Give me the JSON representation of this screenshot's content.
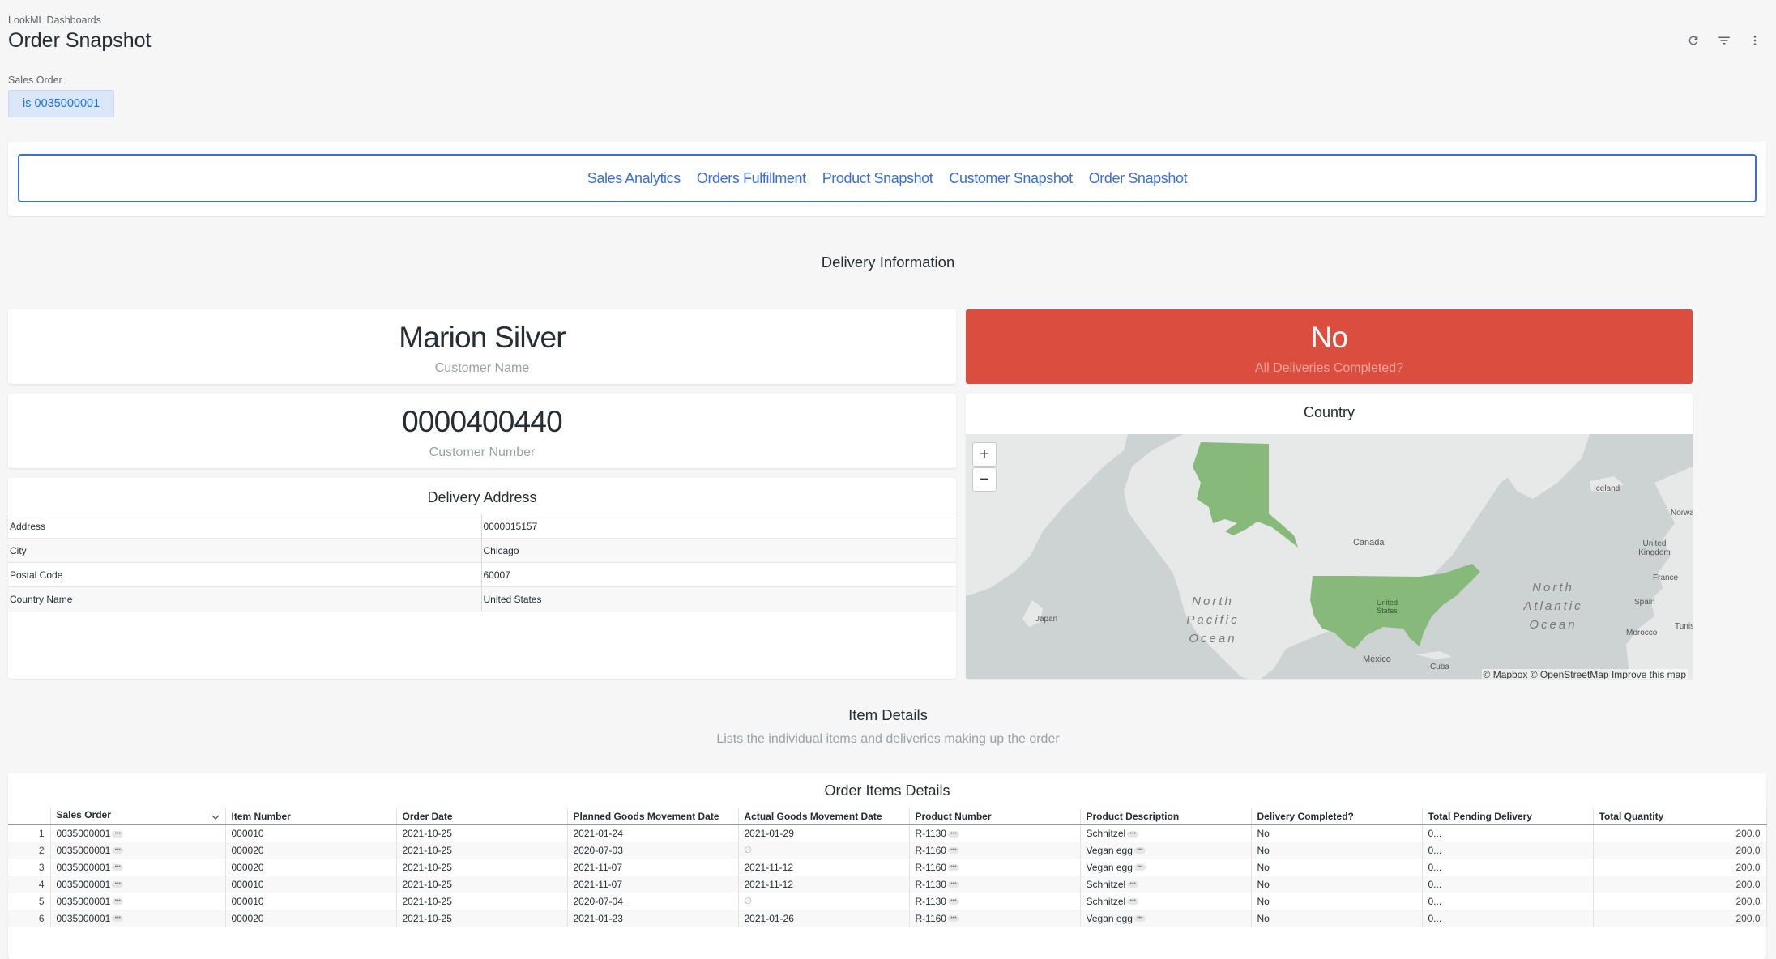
{
  "header": {
    "breadcrumb": "LookML Dashboards",
    "title": "Order Snapshot"
  },
  "filter": {
    "label": "Sales Order",
    "value": "is 0035000001"
  },
  "nav_links": [
    "Sales Analytics",
    "Orders Fulfillment",
    "Product Snapshot",
    "Customer Snapshot",
    "Order Snapshot"
  ],
  "sections": {
    "delivery_title": "Delivery Information",
    "items_title": "Item Details",
    "items_subtitle": "Lists the individual items and deliveries making up the order"
  },
  "kpis": {
    "customer_name": {
      "value": "Marion Silver",
      "label": "Customer Name"
    },
    "customer_number": {
      "value": "0000400440",
      "label": "Customer Number"
    },
    "deliveries_completed": {
      "value": "No",
      "label": "All Deliveries Completed?"
    }
  },
  "delivery_address": {
    "title": "Delivery Address",
    "rows": [
      {
        "field": "Address",
        "value": "0000015157"
      },
      {
        "field": "City",
        "value": "Chicago"
      },
      {
        "field": "Postal Code",
        "value": "60007"
      },
      {
        "field": "Country Name",
        "value": "United States"
      }
    ]
  },
  "map": {
    "title": "Country",
    "zoom_in": "+",
    "zoom_out": "−",
    "labels": {
      "canada": "Canada",
      "united_states": "United States",
      "mexico": "Mexico",
      "cuba": "Cuba",
      "japan": "Japan",
      "iceland": "Iceland",
      "norway": "Norwa",
      "uk": "United Kingdom",
      "france": "France",
      "spain": "Spain",
      "morocco": "Morocco",
      "tunisia": "Tunis",
      "north_pacific": "North Pacific Ocean",
      "north_atlantic": "North Atlantic Ocean"
    },
    "attribution": "© Mapbox © OpenStreetMap Improve this map",
    "highlight_color": "#86b97a",
    "sea_color": "#cdd2d3",
    "land_color": "#e7e9e8"
  },
  "order_items": {
    "title": "Order Items Details",
    "columns": [
      "Sales Order",
      "Item Number",
      "Order Date",
      "Planned Goods Movement Date",
      "Actual Goods Movement Date",
      "Product Number",
      "Product Description",
      "Delivery Completed?",
      "Total Pending Delivery",
      "Total Quantity"
    ],
    "rows": [
      {
        "idx": "1",
        "sales_order": "0035000001",
        "item": "000010",
        "order_date": "2021-10-25",
        "planned": "2021-01-24",
        "actual": "2021-01-29",
        "product": "R-1130",
        "desc": "Schnitzel",
        "completed": "No",
        "pending": "0...",
        "qty": "200.0"
      },
      {
        "idx": "2",
        "sales_order": "0035000001",
        "item": "000020",
        "order_date": "2021-10-25",
        "planned": "2020-07-03",
        "actual": "∅",
        "product": "R-1160",
        "desc": "Vegan egg",
        "completed": "No",
        "pending": "0...",
        "qty": "200.0"
      },
      {
        "idx": "3",
        "sales_order": "0035000001",
        "item": "000020",
        "order_date": "2021-10-25",
        "planned": "2021-11-07",
        "actual": "2021-11-12",
        "product": "R-1160",
        "desc": "Vegan egg",
        "completed": "No",
        "pending": "0...",
        "qty": "200.0"
      },
      {
        "idx": "4",
        "sales_order": "0035000001",
        "item": "000010",
        "order_date": "2021-10-25",
        "planned": "2021-11-07",
        "actual": "2021-11-12",
        "product": "R-1130",
        "desc": "Schnitzel",
        "completed": "No",
        "pending": "0...",
        "qty": "200.0"
      },
      {
        "idx": "5",
        "sales_order": "0035000001",
        "item": "000010",
        "order_date": "2021-10-25",
        "planned": "2020-07-04",
        "actual": "∅",
        "product": "R-1130",
        "desc": "Schnitzel",
        "completed": "No",
        "pending": "0...",
        "qty": "200.0"
      },
      {
        "idx": "6",
        "sales_order": "0035000001",
        "item": "000020",
        "order_date": "2021-10-25",
        "planned": "2021-01-23",
        "actual": "2021-01-26",
        "product": "R-1160",
        "desc": "Vegan egg",
        "completed": "No",
        "pending": "0...",
        "qty": "200.0"
      }
    ]
  },
  "colors": {
    "accent": "#3b6fd6",
    "alert": "#db4e3f",
    "filter_bg": "#dbe7f8"
  },
  "icons": {
    "refresh": "refresh-icon",
    "filter": "filter-icon",
    "more": "more-vertical-icon"
  }
}
